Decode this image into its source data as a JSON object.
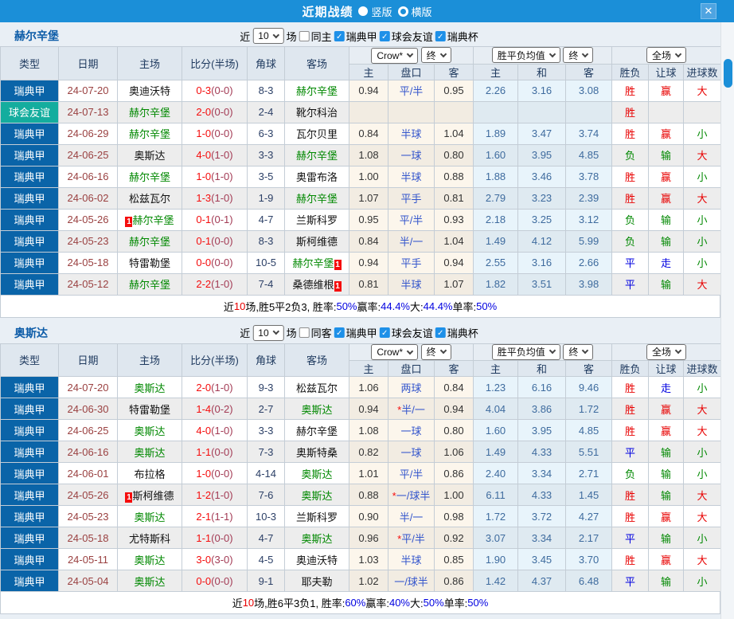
{
  "titlebar": {
    "title": "近期战绩",
    "vertical_label": "竖版",
    "horizontal_label": "横版",
    "close_label": "✕"
  },
  "filters": {
    "near": "近",
    "count": "10",
    "games": "场",
    "leagues": [
      "瑞典甲",
      "球会友谊",
      "瑞典杯"
    ]
  },
  "table_header": {
    "type": "类型",
    "date": "日期",
    "home": "主场",
    "score": "比分(半场)",
    "corner": "角球",
    "away": "客场",
    "crow": "Crow*",
    "final1": "终",
    "avg": "胜平负均值",
    "final2": "终",
    "scope": "全场",
    "h": "主",
    "handicap": "盘口",
    "a": "客",
    "h2": "主",
    "draw": "和",
    "a2": "客",
    "result": "胜负",
    "let_goal": "让球",
    "goals": "进球数"
  },
  "colors": {
    "titlebar": "#1b8fd8",
    "league_cell": "#0a64a8",
    "friendly_cell": "#14ad9e",
    "win_red": "#e80000",
    "lose_green": "#008800",
    "draw_blue": "#0000e0",
    "highlight_team_green": "#008800",
    "score_red": "#f50d0d"
  },
  "sections": [
    {
      "team": "赫尔辛堡",
      "same": "同主",
      "rows": [
        {
          "lg": "瑞典甲",
          "kind": "league",
          "date": "24-07-20",
          "home": "奥迪沃特",
          "hb": false,
          "hhl": false,
          "score": "0-3",
          "half": "(0-0)",
          "cor": "8-3",
          "away": "赫尔辛堡",
          "ab": false,
          "ahl": true,
          "o1": "0.94",
          "hc": "平/半",
          "o2": "0.95",
          "m1": "2.26",
          "m2": "3.16",
          "m3": "3.08",
          "r1": "胜",
          "r2": "赢",
          "r3": "大"
        },
        {
          "lg": "球会友谊",
          "kind": "friendly",
          "date": "24-07-13",
          "home": "赫尔辛堡",
          "hb": false,
          "hhl": true,
          "score": "2-0",
          "half": "(0-0)",
          "cor": "2-4",
          "away": "靴尔科治",
          "ab": false,
          "ahl": false,
          "o1": "",
          "hc": "",
          "o2": "",
          "m1": "",
          "m2": "",
          "m3": "",
          "r1": "胜",
          "r2": "",
          "r3": ""
        },
        {
          "lg": "瑞典甲",
          "kind": "league",
          "date": "24-06-29",
          "home": "赫尔辛堡",
          "hb": false,
          "hhl": true,
          "score": "1-0",
          "half": "(0-0)",
          "cor": "6-3",
          "away": "瓦尔贝里",
          "ab": false,
          "ahl": false,
          "o1": "0.84",
          "hc": "半球",
          "o2": "1.04",
          "m1": "1.89",
          "m2": "3.47",
          "m3": "3.74",
          "r1": "胜",
          "r2": "赢",
          "r3": "小"
        },
        {
          "lg": "瑞典甲",
          "kind": "league",
          "date": "24-06-25",
          "home": "奥斯达",
          "hb": false,
          "hhl": false,
          "score": "4-0",
          "half": "(1-0)",
          "cor": "3-3",
          "away": "赫尔辛堡",
          "ab": false,
          "ahl": true,
          "o1": "1.08",
          "hc": "一球",
          "o2": "0.80",
          "m1": "1.60",
          "m2": "3.95",
          "m3": "4.85",
          "r1": "负",
          "r2": "输",
          "r3": "大"
        },
        {
          "lg": "瑞典甲",
          "kind": "league",
          "date": "24-06-16",
          "home": "赫尔辛堡",
          "hb": false,
          "hhl": true,
          "score": "1-0",
          "half": "(1-0)",
          "cor": "3-5",
          "away": "奥雷布洛",
          "ab": false,
          "ahl": false,
          "o1": "1.00",
          "hc": "半球",
          "o2": "0.88",
          "m1": "1.88",
          "m2": "3.46",
          "m3": "3.78",
          "r1": "胜",
          "r2": "赢",
          "r3": "小"
        },
        {
          "lg": "瑞典甲",
          "kind": "league",
          "date": "24-06-02",
          "home": "松兹瓦尔",
          "hb": false,
          "hhl": false,
          "score": "1-3",
          "half": "(1-0)",
          "cor": "1-9",
          "away": "赫尔辛堡",
          "ab": false,
          "ahl": true,
          "o1": "1.07",
          "hc": "平手",
          "o2": "0.81",
          "m1": "2.79",
          "m2": "3.23",
          "m3": "2.39",
          "r1": "胜",
          "r2": "赢",
          "r3": "大"
        },
        {
          "lg": "瑞典甲",
          "kind": "league",
          "date": "24-05-26",
          "home": "赫尔辛堡",
          "hb": true,
          "hhl": true,
          "score": "0-1",
          "half": "(0-1)",
          "cor": "4-7",
          "away": "兰斯科罗",
          "ab": false,
          "ahl": false,
          "o1": "0.95",
          "hc": "平/半",
          "o2": "0.93",
          "m1": "2.18",
          "m2": "3.25",
          "m3": "3.12",
          "r1": "负",
          "r2": "输",
          "r3": "小"
        },
        {
          "lg": "瑞典甲",
          "kind": "league",
          "date": "24-05-23",
          "home": "赫尔辛堡",
          "hb": false,
          "hhl": true,
          "score": "0-1",
          "half": "(0-0)",
          "cor": "8-3",
          "away": "斯柯维德",
          "ab": false,
          "ahl": false,
          "o1": "0.84",
          "hc": "半/一",
          "o2": "1.04",
          "m1": "1.49",
          "m2": "4.12",
          "m3": "5.99",
          "r1": "负",
          "r2": "输",
          "r3": "小"
        },
        {
          "lg": "瑞典甲",
          "kind": "league",
          "date": "24-05-18",
          "home": "特雷勒堡",
          "hb": false,
          "hhl": false,
          "score": "0-0",
          "half": "(0-0)",
          "cor": "10-5",
          "away": "赫尔辛堡",
          "ab": true,
          "ahl": true,
          "o1": "0.94",
          "hc": "平手",
          "o2": "0.94",
          "m1": "2.55",
          "m2": "3.16",
          "m3": "2.66",
          "r1": "平",
          "r2": "走",
          "r3": "小"
        },
        {
          "lg": "瑞典甲",
          "kind": "league",
          "date": "24-05-12",
          "home": "赫尔辛堡",
          "hb": false,
          "hhl": true,
          "score": "2-2",
          "half": "(1-0)",
          "cor": "7-4",
          "away": "桑德维根",
          "ab": true,
          "ahl": false,
          "o1": "0.81",
          "hc": "半球",
          "o2": "1.07",
          "m1": "1.82",
          "m2": "3.51",
          "m3": "3.98",
          "r1": "平",
          "r2": "输",
          "r3": "大"
        }
      ],
      "summary": [
        {
          "t": "近"
        },
        {
          "t": "10",
          "c": "red"
        },
        {
          "t": "场,胜5平2负3, 胜率:"
        },
        {
          "t": "50%",
          "c": "blue"
        },
        {
          "t": " 赢率:"
        },
        {
          "t": "44.4%",
          "c": "blue"
        },
        {
          "t": " 大:"
        },
        {
          "t": "44.4%",
          "c": "blue"
        },
        {
          "t": " 单率:"
        },
        {
          "t": "50%",
          "c": "blue"
        }
      ]
    },
    {
      "team": "奥斯达",
      "same": "同客",
      "rows": [
        {
          "lg": "瑞典甲",
          "kind": "league",
          "date": "24-07-20",
          "home": "奥斯达",
          "hb": false,
          "hhl": true,
          "score": "2-0",
          "half": "(1-0)",
          "cor": "9-3",
          "away": "松兹瓦尔",
          "ab": false,
          "ahl": false,
          "o1": "1.06",
          "hc": "两球",
          "o2": "0.84",
          "m1": "1.23",
          "m2": "6.16",
          "m3": "9.46",
          "r1": "胜",
          "r2": "走",
          "r3": "小"
        },
        {
          "lg": "瑞典甲",
          "kind": "league",
          "date": "24-06-30",
          "home": "特雷勒堡",
          "hb": false,
          "hhl": false,
          "score": "1-4",
          "half": "(0-2)",
          "cor": "2-7",
          "away": "奥斯达",
          "ab": false,
          "ahl": true,
          "o1": "0.94",
          "hc": "*半/一",
          "o2": "0.94",
          "m1": "4.04",
          "m2": "3.86",
          "m3": "1.72",
          "r1": "胜",
          "r2": "赢",
          "r3": "大"
        },
        {
          "lg": "瑞典甲",
          "kind": "league",
          "date": "24-06-25",
          "home": "奥斯达",
          "hb": false,
          "hhl": true,
          "score": "4-0",
          "half": "(1-0)",
          "cor": "3-3",
          "away": "赫尔辛堡",
          "ab": false,
          "ahl": false,
          "o1": "1.08",
          "hc": "一球",
          "o2": "0.80",
          "m1": "1.60",
          "m2": "3.95",
          "m3": "4.85",
          "r1": "胜",
          "r2": "赢",
          "r3": "大"
        },
        {
          "lg": "瑞典甲",
          "kind": "league",
          "date": "24-06-16",
          "home": "奥斯达",
          "hb": false,
          "hhl": true,
          "score": "1-1",
          "half": "(0-0)",
          "cor": "7-3",
          "away": "奥斯特桑",
          "ab": false,
          "ahl": false,
          "o1": "0.82",
          "hc": "一球",
          "o2": "1.06",
          "m1": "1.49",
          "m2": "4.33",
          "m3": "5.51",
          "r1": "平",
          "r2": "输",
          "r3": "小"
        },
        {
          "lg": "瑞典甲",
          "kind": "league",
          "date": "24-06-01",
          "home": "布拉格",
          "hb": false,
          "hhl": false,
          "score": "1-0",
          "half": "(0-0)",
          "cor": "4-14",
          "away": "奥斯达",
          "ab": false,
          "ahl": true,
          "o1": "1.01",
          "hc": "平/半",
          "o2": "0.86",
          "m1": "2.40",
          "m2": "3.34",
          "m3": "2.71",
          "r1": "负",
          "r2": "输",
          "r3": "小"
        },
        {
          "lg": "瑞典甲",
          "kind": "league",
          "date": "24-05-26",
          "home": "斯柯维德",
          "hb": true,
          "hhl": false,
          "score": "1-2",
          "half": "(1-0)",
          "cor": "7-6",
          "away": "奥斯达",
          "ab": false,
          "ahl": true,
          "o1": "0.88",
          "hc": "*一/球半",
          "o2": "1.00",
          "m1": "6.11",
          "m2": "4.33",
          "m3": "1.45",
          "r1": "胜",
          "r2": "输",
          "r3": "大"
        },
        {
          "lg": "瑞典甲",
          "kind": "league",
          "date": "24-05-23",
          "home": "奥斯达",
          "hb": false,
          "hhl": true,
          "score": "2-1",
          "half": "(1-1)",
          "cor": "10-3",
          "away": "兰斯科罗",
          "ab": false,
          "ahl": false,
          "o1": "0.90",
          "hc": "半/一",
          "o2": "0.98",
          "m1": "1.72",
          "m2": "3.72",
          "m3": "4.27",
          "r1": "胜",
          "r2": "赢",
          "r3": "大"
        },
        {
          "lg": "瑞典甲",
          "kind": "league",
          "date": "24-05-18",
          "home": "尤特斯科",
          "hb": false,
          "hhl": false,
          "score": "1-1",
          "half": "(0-0)",
          "cor": "4-7",
          "away": "奥斯达",
          "ab": false,
          "ahl": true,
          "o1": "0.96",
          "hc": "*平/半",
          "o2": "0.92",
          "m1": "3.07",
          "m2": "3.34",
          "m3": "2.17",
          "r1": "平",
          "r2": "输",
          "r3": "小"
        },
        {
          "lg": "瑞典甲",
          "kind": "league",
          "date": "24-05-11",
          "home": "奥斯达",
          "hb": false,
          "hhl": true,
          "score": "3-0",
          "half": "(3-0)",
          "cor": "4-5",
          "away": "奥迪沃特",
          "ab": false,
          "ahl": false,
          "o1": "1.03",
          "hc": "半球",
          "o2": "0.85",
          "m1": "1.90",
          "m2": "3.45",
          "m3": "3.70",
          "r1": "胜",
          "r2": "赢",
          "r3": "大"
        },
        {
          "lg": "瑞典甲",
          "kind": "league",
          "date": "24-05-04",
          "home": "奥斯达",
          "hb": false,
          "hhl": true,
          "score": "0-0",
          "half": "(0-0)",
          "cor": "9-1",
          "away": "耶夫勒",
          "ab": false,
          "ahl": false,
          "o1": "1.02",
          "hc": "一/球半",
          "o2": "0.86",
          "m1": "1.42",
          "m2": "4.37",
          "m3": "6.48",
          "r1": "平",
          "r2": "输",
          "r3": "小"
        }
      ],
      "summary": [
        {
          "t": "近"
        },
        {
          "t": "10",
          "c": "red"
        },
        {
          "t": "场,胜6平3负1, 胜率:"
        },
        {
          "t": "60%",
          "c": "blue"
        },
        {
          "t": " 赢率:"
        },
        {
          "t": "40%",
          "c": "blue"
        },
        {
          "t": " 大:"
        },
        {
          "t": "50%",
          "c": "blue"
        },
        {
          "t": " 单率:"
        },
        {
          "t": "50%",
          "c": "blue"
        }
      ]
    }
  ]
}
